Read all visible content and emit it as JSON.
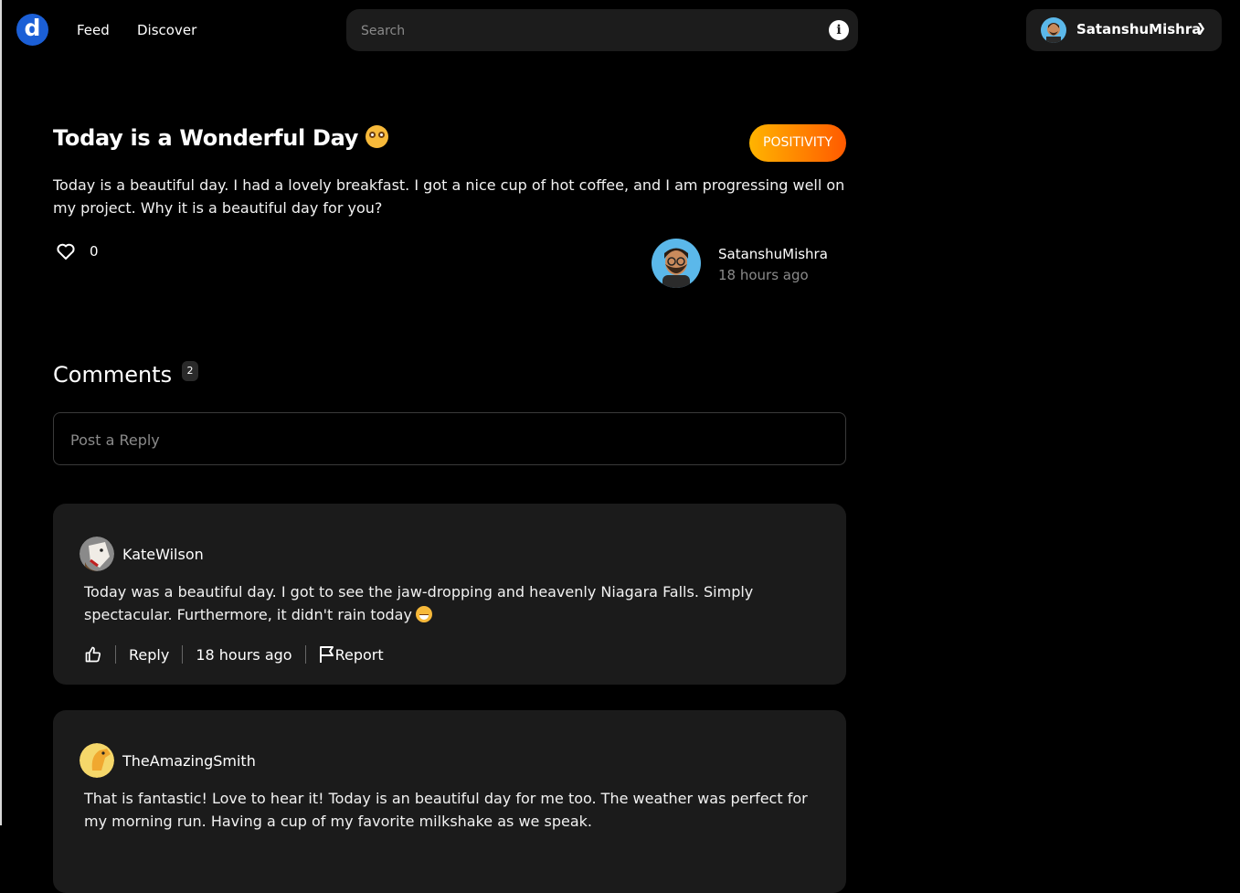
{
  "header": {
    "logo_letter": "d",
    "nav": [
      "Feed",
      "Discover"
    ],
    "search_placeholder": "Search",
    "user_name": "SatanshuMishra"
  },
  "post": {
    "title": "Today is a Wonderful Day",
    "tag": "POSITIVITY",
    "body": "Today is a beautiful day. I had a lovely breakfast. I got a nice cup of hot coffee, and I am progressing well on my project. Why it is a beautiful day for you?",
    "likes": "0",
    "author": "SatanshuMishra",
    "time": "18 hours ago"
  },
  "comments": {
    "heading": "Comments",
    "count": "2",
    "reply_placeholder": "Post a Reply",
    "items": [
      {
        "author": "KateWilson",
        "text": "Today was a beautiful day. I got to see the jaw-dropping and heavenly Niagara Falls. Simply spectacular. Furthermore, it didn't rain today",
        "reply_label": "Reply",
        "time": "18 hours ago",
        "report_label": "Report"
      },
      {
        "author": "TheAmazingSmith",
        "text": "That is fantastic! Love to hear it! Today is an beautiful day for me too. The weather was perfect for my morning run. Having a cup of my favorite milkshake as we speak."
      }
    ]
  },
  "colors": {
    "background": "#000000",
    "card": "#1b1b1b",
    "accent_gradient_start": "#ffb400",
    "accent_gradient_end": "#ff5a00",
    "logo": "#1b5fd6"
  }
}
